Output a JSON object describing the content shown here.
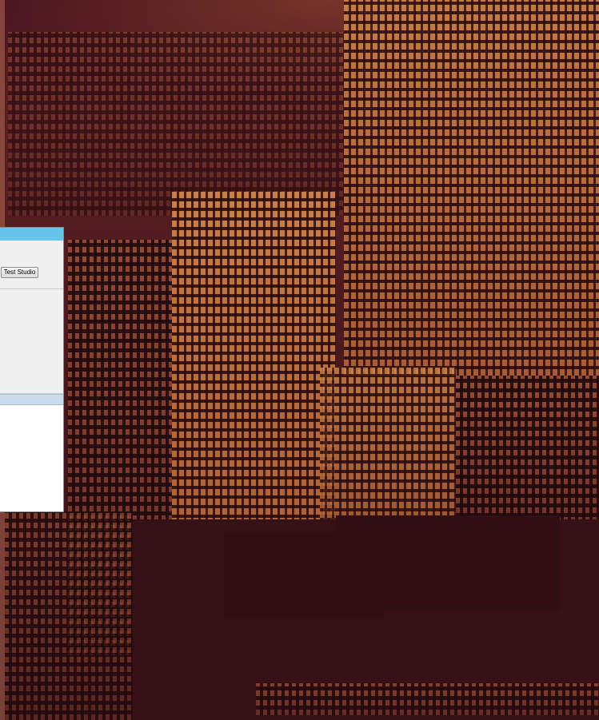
{
  "desktop": {
    "wallpaper": "city-skyline-night",
    "tint_colors": {
      "dark": "#3a1218",
      "light": "#d68a4a"
    }
  },
  "app_window": {
    "toolbar": {
      "test_studio_label": "Test Studio"
    },
    "titlebar_color": "#67c3ea"
  }
}
